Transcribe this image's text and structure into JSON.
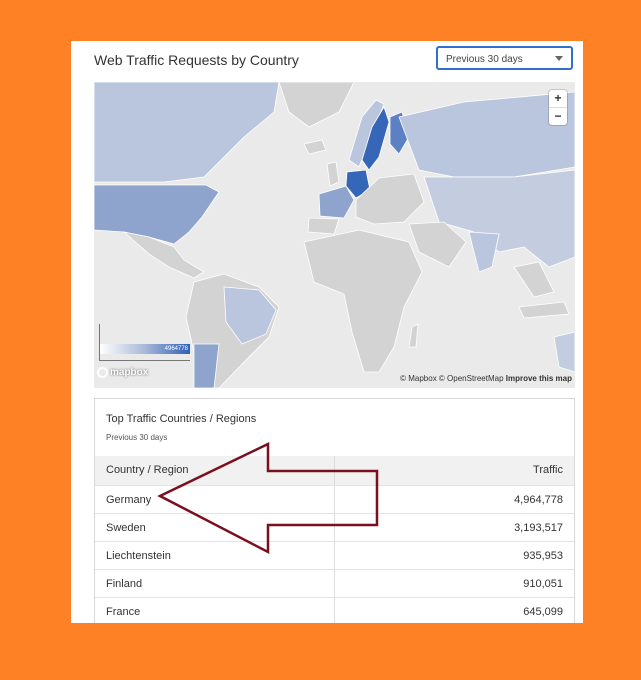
{
  "widget": {
    "title": "Web Traffic Requests by Country",
    "period_select": {
      "value": "Previous 30 days"
    }
  },
  "map": {
    "zoom_in_label": "+",
    "zoom_out_label": "−",
    "legend_max": "4964778",
    "logo_text": "mapbox",
    "attribution": {
      "mapbox": "© Mapbox",
      "osm": "© OpenStreetMap",
      "improve": "Improve this map"
    },
    "colors": {
      "land": "#d3d3d3",
      "water": "#eaeaea",
      "low": "#b9c6de",
      "mid": "#8ea4cc",
      "high": "#3566b8"
    }
  },
  "table": {
    "title": "Top Traffic Countries / Regions",
    "subtitle": "Previous 30 days",
    "columns": [
      "Country / Region",
      "Traffic"
    ],
    "rows": [
      {
        "country": "Germany",
        "traffic": "4,964,778"
      },
      {
        "country": "Sweden",
        "traffic": "3,193,517"
      },
      {
        "country": "Liechtenstein",
        "traffic": "935,953"
      },
      {
        "country": "Finland",
        "traffic": "910,051"
      },
      {
        "country": "France",
        "traffic": "645,099"
      }
    ]
  },
  "annotation": {
    "arrow_color": "#7a0f1e"
  }
}
